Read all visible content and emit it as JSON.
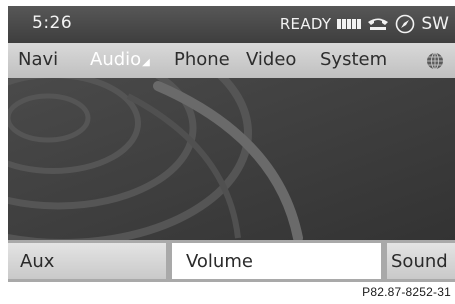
{
  "status_bar": {
    "time": "5:26",
    "status_text": "READY",
    "signal_bars": 5,
    "region_text": "SW",
    "icons": [
      "signal-icon",
      "phone-icon",
      "compass-icon"
    ]
  },
  "main_menu": {
    "items": [
      {
        "label": "Navi",
        "selected": false
      },
      {
        "label": "Audio",
        "selected": true
      },
      {
        "label": "Phone",
        "selected": false
      },
      {
        "label": "Video",
        "selected": false
      },
      {
        "label": "System",
        "selected": false
      }
    ],
    "trailing_icon": "globe-icon"
  },
  "softkeys": {
    "items": [
      {
        "label": "Aux",
        "selected": false
      },
      {
        "label": "Volume",
        "selected": true
      },
      {
        "label": "Sound",
        "selected": false
      }
    ]
  },
  "figure_ref": "P82.87-8252-31",
  "colors": {
    "status_bar": "#4a4a4a",
    "menu_bar": "#cfcfcf",
    "selected_menu_text": "#ffffff",
    "display_bg": "#3c3c3c",
    "selected_softkey": "#ffffff"
  }
}
